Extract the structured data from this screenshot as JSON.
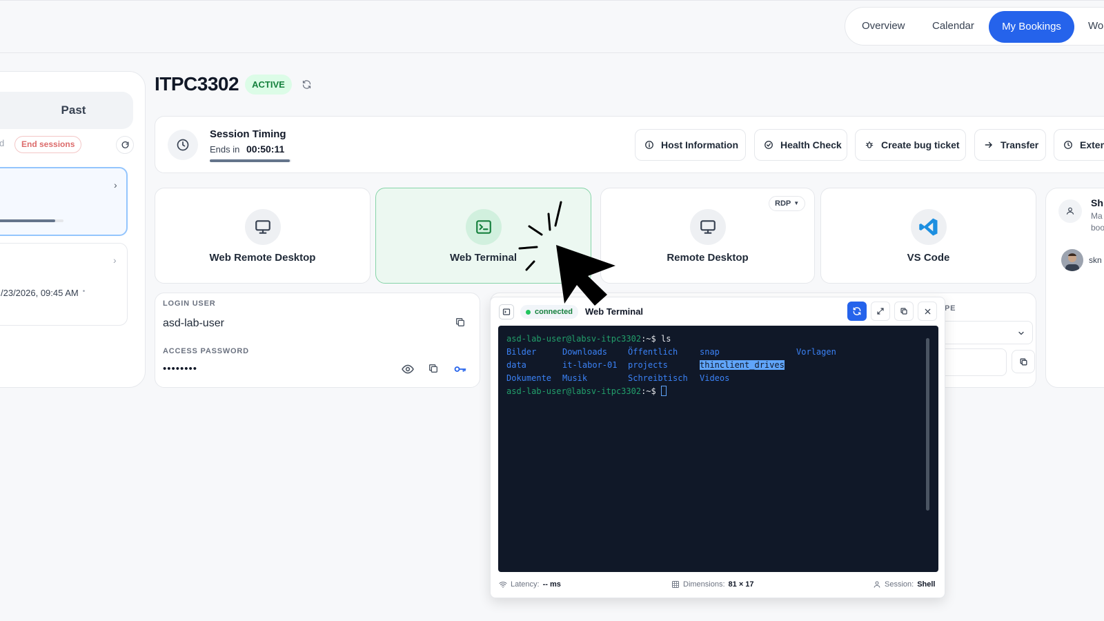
{
  "nav": {
    "items": [
      "Overview",
      "Calendar",
      "My Bookings",
      "Wo"
    ],
    "active": "My Bookings"
  },
  "left": {
    "tab_past": "Past",
    "pill_cut": "d",
    "end_sessions": "End sessions",
    "card2_date": "/23/2026, 09:45 AM",
    "card2_dot": "•"
  },
  "host": {
    "name": "ITPC3302",
    "status": "ACTIVE"
  },
  "timing": {
    "title": "Session Timing",
    "ends_label": "Ends in",
    "remaining": "00:50:11",
    "progress_percent": 98
  },
  "actions": [
    "Host Information",
    "Health Check",
    "Create bug ticket",
    "Transfer",
    "Exten"
  ],
  "tiles": {
    "web_remote_desktop": "Web Remote Desktop",
    "web_terminal": "Web Terminal",
    "remote_desktop": "Remote Desktop",
    "protocol": "RDP",
    "vs_code": "VS Code"
  },
  "share": {
    "title_cut": "Sh",
    "line1": "Ma",
    "line2": "boo",
    "user_cut": "skn"
  },
  "login": {
    "user_label": "LOGIN USER",
    "user_value": "asd-lab-user",
    "password_label": "ACCESS PASSWORD",
    "password_value": "••••••••"
  },
  "partial_panel": {
    "label_cut": "PE"
  },
  "terminal": {
    "status": "connected",
    "title": "Web Terminal",
    "prompt": "asd-lab-user@labsv-itpc3302",
    "prompt_suffix": ":~$",
    "command": " ls",
    "row1": [
      "Bilder",
      "Downloads",
      "Öffentlich",
      "snap",
      "Vorlagen"
    ],
    "row2": [
      "data",
      "it-labor-01",
      "projects",
      "thinclient_drives"
    ],
    "row3": [
      "Dokumente",
      "Musik",
      "Schreibtisch",
      "Videos"
    ],
    "latency_label": "Latency:",
    "latency_value": "-- ms",
    "dimensions_label": "Dimensions:",
    "dimensions_value": "81 × 17",
    "session_label": "Session:",
    "session_value": "Shell"
  },
  "colors": {
    "accent": "#2563eb",
    "active_green": "#15803d",
    "terminal_bg": "#101828",
    "terminal_tile_bg": "#ecf8f1"
  }
}
